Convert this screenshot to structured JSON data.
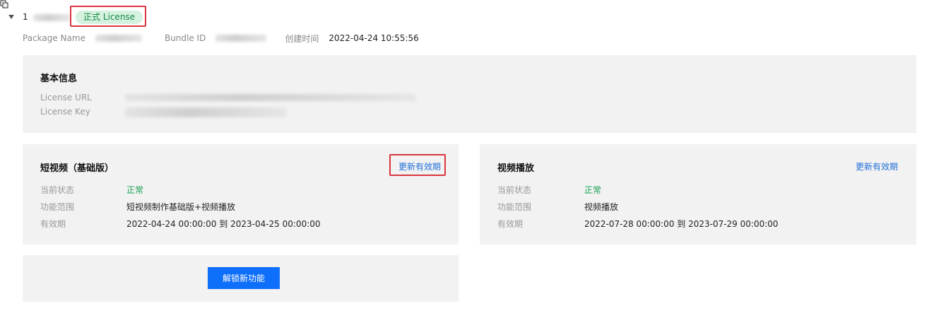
{
  "license": {
    "id_prefix": "1",
    "badge": "正式 License"
  },
  "meta": {
    "package_name_label": "Package Name",
    "bundle_id_label": "Bundle ID",
    "created_label": "创建时间",
    "created_value": "2022-04-24 10:55:56"
  },
  "basic_info": {
    "title": "基本信息",
    "license_url_label": "License URL",
    "license_key_label": "License Key"
  },
  "short_video": {
    "title": "短视频（基础版）",
    "renew_label": "更新有效期",
    "status_label": "当前状态",
    "status_value": "正常",
    "scope_label": "功能范围",
    "scope_value": "短视频制作基础版+视频播放",
    "validity_label": "有效期",
    "validity_value": "2022-04-24 00:00:00 到 2023-04-25 00:00:00"
  },
  "video_playback": {
    "title": "视频播放",
    "renew_label": "更新有效期",
    "status_label": "当前状态",
    "status_value": "正常",
    "scope_label": "功能范围",
    "scope_value": "视频播放",
    "validity_label": "有效期",
    "validity_value": "2022-07-28 00:00:00 到 2023-07-29 00:00:00"
  },
  "unlock": {
    "button_label": "解锁新功能"
  },
  "colors": {
    "accent": "#0e6ffb",
    "status_ok": "#1aa255",
    "highlight": "#d9363e",
    "badge_bg": "#d5f1df",
    "panel_bg": "#f2f2f2"
  }
}
